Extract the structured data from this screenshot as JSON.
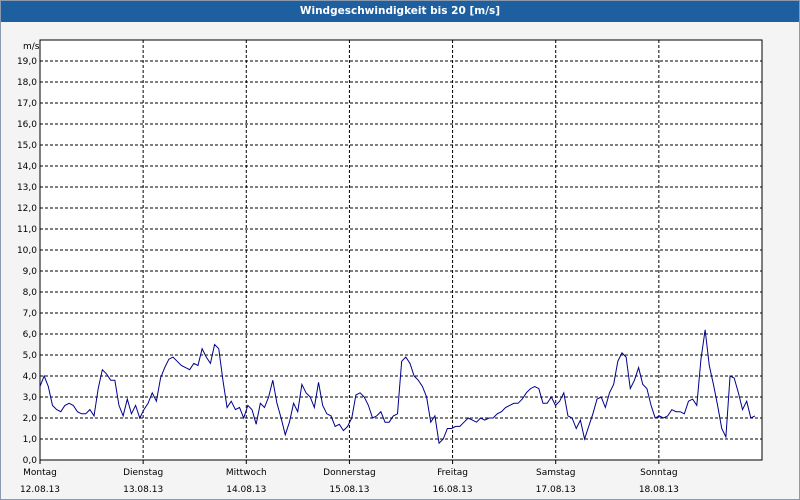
{
  "window": {
    "title": "Windgeschwindigkeit bis 20 [m/s]"
  },
  "chart_data": {
    "type": "line",
    "title": "Windgeschwindigkeit bis 20 [m/s]",
    "ylabel": "m/s",
    "xlabel": "",
    "ylim": [
      0,
      20
    ],
    "y_ticks": [
      "0,0",
      "1,0",
      "2,0",
      "3,0",
      "4,0",
      "5,0",
      "6,0",
      "7,0",
      "8,0",
      "9,0",
      "10,0",
      "11,0",
      "12,0",
      "13,0",
      "14,0",
      "15,0",
      "16,0",
      "17,0",
      "18,0",
      "19,0"
    ],
    "x_ticks": [
      {
        "day": "Montag",
        "date": "12.08.13"
      },
      {
        "day": "Dienstag",
        "date": "13.08.13"
      },
      {
        "day": "Mittwoch",
        "date": "14.08.13"
      },
      {
        "day": "Donnerstag",
        "date": "15.08.13"
      },
      {
        "day": "Freitag",
        "date": "16.08.13"
      },
      {
        "day": "Samstag",
        "date": "17.08.13"
      },
      {
        "day": "Sonntag",
        "date": "18.08.13"
      }
    ],
    "grid": true,
    "line_color": "#00008b",
    "series": [
      {
        "name": "",
        "values": [
          3.5,
          4.0,
          3.5,
          2.6,
          2.4,
          2.3,
          2.6,
          2.7,
          2.6,
          2.3,
          2.2,
          2.2,
          2.4,
          2.1,
          3.4,
          4.3,
          4.1,
          3.8,
          3.8,
          2.6,
          2.1,
          2.9,
          2.2,
          2.6,
          2.0,
          2.4,
          2.7,
          3.2,
          2.8,
          3.9,
          4.4,
          4.8,
          4.9,
          4.7,
          4.5,
          4.4,
          4.3,
          4.6,
          4.5,
          5.3,
          4.9,
          4.6,
          5.5,
          5.3,
          3.8,
          2.5,
          2.8,
          2.4,
          2.5,
          2.0,
          2.6,
          2.4,
          1.7,
          2.7,
          2.5,
          3.0,
          3.8,
          2.7,
          2.0,
          1.2,
          1.8,
          2.7,
          2.3,
          3.6,
          3.2,
          3.0,
          2.5,
          3.7,
          2.6,
          2.2,
          2.1,
          1.6,
          1.7,
          1.4,
          1.6,
          2.0,
          3.1,
          3.2,
          3.0,
          2.6,
          2.0,
          2.1,
          2.3,
          1.8,
          1.8,
          2.1,
          2.2,
          4.7,
          4.9,
          4.6,
          4.0,
          3.8,
          3.5,
          3.0,
          1.8,
          2.1,
          0.8,
          1.0,
          1.5,
          1.5,
          1.6,
          1.6,
          1.8,
          2.0,
          1.9,
          1.8,
          2.0,
          1.9,
          2.0,
          2.0,
          2.2,
          2.3,
          2.5,
          2.6,
          2.7,
          2.7,
          2.9,
          3.2,
          3.4,
          3.5,
          3.4,
          2.7,
          2.7,
          3.0,
          2.6,
          2.8,
          3.2,
          2.1,
          2.0,
          1.5,
          1.9,
          1.0,
          1.6,
          2.2,
          2.9,
          3.0,
          2.5,
          3.2,
          3.6,
          4.7,
          5.1,
          4.9,
          3.4,
          3.8,
          4.4,
          3.6,
          3.4,
          2.6,
          2.0,
          2.1,
          2.0,
          2.1,
          2.4,
          2.3,
          2.3,
          2.2,
          2.8,
          2.9,
          2.6,
          4.8,
          6.2,
          4.5,
          3.6,
          2.6,
          1.5,
          1.1,
          4.0,
          3.9,
          3.2,
          2.4,
          2.8,
          2.0,
          2.1
        ]
      }
    ]
  }
}
